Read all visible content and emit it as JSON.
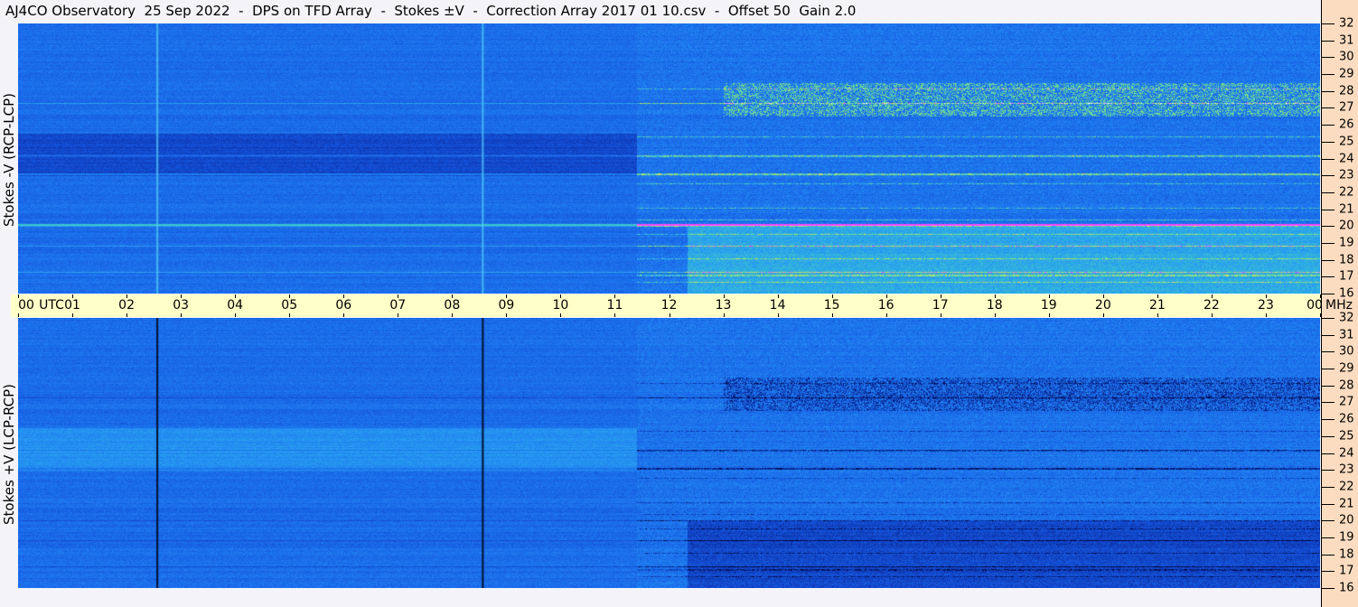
{
  "title": "AJ4CO Observatory  25 Sep 2022  -  DPS on TFD Array  -  Stokes ±V  -  Correction Array 2017 01 10.csv  -  Offset 50  Gain 2.0",
  "chart_data": {
    "type": "heatmap",
    "title": "AJ4CO Observatory  25 Sep 2022  -  DPS on TFD Array  -  Stokes ±V  -  Correction Array 2017 01 10.csv  -  Offset 50  Gain 2.0",
    "xlabel": "UTC",
    "ylabel_unit": "MHz",
    "xlim": [
      0,
      24
    ],
    "ylim": [
      16,
      32
    ],
    "x_ticks": [
      "00",
      "01",
      "02",
      "03",
      "04",
      "05",
      "06",
      "07",
      "08",
      "09",
      "10",
      "11",
      "12",
      "13",
      "14",
      "15",
      "16",
      "17",
      "18",
      "19",
      "20",
      "21",
      "22",
      "23",
      "00"
    ],
    "y_ticks": [
      "32",
      "31",
      "30",
      "29",
      "28",
      "27",
      "26",
      "25",
      "24",
      "23",
      "22",
      "21",
      "20",
      "19",
      "18",
      "17",
      "16"
    ],
    "panels": [
      {
        "name": "Stokes -V (RCP-LCP)",
        "label": "Stokes -V  (RCP-LCP)",
        "sign": -1
      },
      {
        "name": "Stokes +V (LCP-RCP)",
        "label": "Stokes +V  (LCP-RCP)",
        "sign": 1
      }
    ],
    "vertical_markers_utc": [
      2.55,
      8.55
    ],
    "sunrise_transition_utc": 11.4,
    "colormap": [
      "#000033",
      "#0a2a9a",
      "#1450d8",
      "#1e78f0",
      "#28a0f0",
      "#40c8c8",
      "#80e080",
      "#e0f040",
      "#ff40ff",
      "#ffffff"
    ]
  },
  "axis": {
    "utc_label": "UTC",
    "mhz_label": "MHz"
  }
}
